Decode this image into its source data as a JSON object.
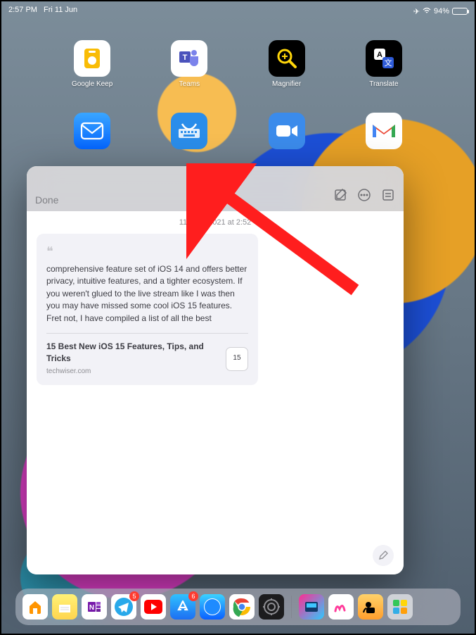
{
  "status": {
    "time": "2:57 PM",
    "date": "Fri 11 Jun",
    "battery": "94%"
  },
  "home": {
    "row1": [
      {
        "name": "google-keep",
        "label": "Google Keep"
      },
      {
        "name": "teams",
        "label": "Teams"
      },
      {
        "name": "magnifier",
        "label": "Magnifier"
      },
      {
        "name": "translate",
        "label": "Translate"
      }
    ]
  },
  "note": {
    "done_label": "Done",
    "timestamp": "11 June 2021 at 2:52",
    "excerpt": "comprehensive feature set of iOS 14 and offers better privacy, intuitive features, and a tighter ecosystem. If you weren't glued to the live stream like I was then you may have missed some cool iOS 15 features. Fret not, I have compiled a list of all the best",
    "link_title": "15 Best New iOS 15 Features, Tips, and Tricks",
    "link_domain": "techwiser.com",
    "link_badge": "15"
  },
  "dock": {
    "telegram_badge": "5",
    "appstore_badge": "6"
  }
}
